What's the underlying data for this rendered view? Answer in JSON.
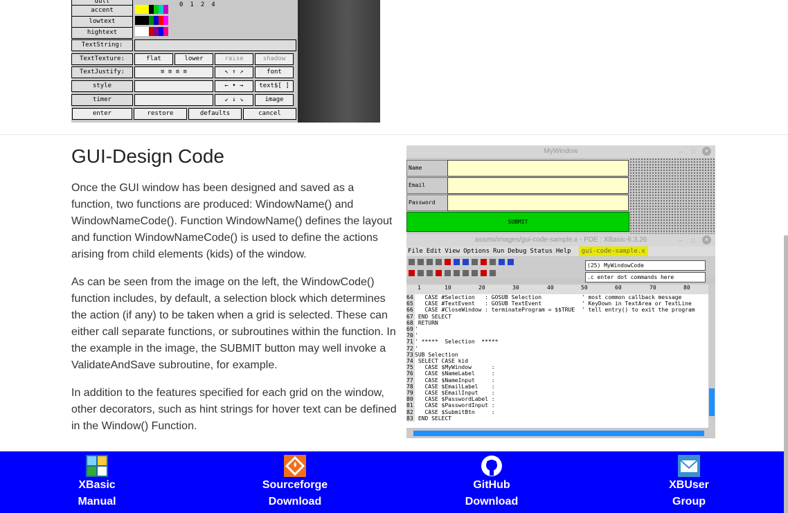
{
  "designer": {
    "rows": [
      {
        "label": "accent"
      },
      {
        "label": "lowtext"
      },
      {
        "label": "hightext"
      },
      {
        "label": "TextString:"
      },
      {
        "label": "TextTexture:",
        "buttons": [
          "flat",
          "lower",
          "raise",
          "shadow"
        ]
      },
      {
        "label": "TextJustify:",
        "buttons": [
          "font"
        ]
      },
      {
        "label": "style",
        "buttons": [
          "text$[ ]"
        ]
      },
      {
        "label": "timer",
        "buttons": [
          "image"
        ]
      }
    ],
    "numbers": [
      "0",
      "1",
      "2",
      "4"
    ],
    "bottom_buttons": [
      "enter",
      "restore",
      "defaults",
      "cancel"
    ]
  },
  "section": {
    "title": "GUI-Design Code",
    "paragraphs": [
      "Once the GUI window has been designed and saved as a function, two functions are produced: WindowName() and WindowNameCode(). Function WindowName() defines the layout and function WindowNameCode() is used to define the actions arising from child elements (kids) of the window.",
      "As can be seen from the image on the left, the WindowCode() function includes, by default, a selection block which determines the action (if any) to be taken when a grid is selected. These can either call separate functions, or subroutines within the function. In the example in the image, the SUBMIT button may well invoke a ValidateAndSave subroutine, for example.",
      "In addition to the features specified for each grid on the window, other decorators, such as hint strings for hover text can be defined in the Window() Function."
    ]
  },
  "screenshot": {
    "mywindow_title": "MyWindow",
    "labels": [
      "Name",
      "Email",
      "Password"
    ],
    "submit_label": "SUBMIT",
    "pde_title": "assets/images/gui-code-sample.x - PDE : XBasic-6.3.26",
    "menu": [
      "File",
      "Edit",
      "View",
      "Options",
      "Run",
      "Debug",
      "Status",
      "Help"
    ],
    "file_tag": "gui-code-sample.x",
    "func_select": "(25) MyWindowCode",
    "command_placeholder": ".c enter dot commands here",
    "ruler": [
      "1",
      "10",
      "20",
      "30",
      "40",
      "50",
      "60",
      "70",
      "80"
    ],
    "code_lines": [
      {
        "n": "64",
        "t": "   CASE #Selection   : GOSUB Selection            ' most common callback message"
      },
      {
        "n": "65",
        "t": "   CASE #TextEvent   : GOSUB TextEvent            ' KeyDown in TextArea or TextLine"
      },
      {
        "n": "66",
        "t": "   CASE #CloseWindow : terminateProgram = $$TRUE  ' tell entry() to exit the program"
      },
      {
        "n": "67",
        "t": " END SELECT"
      },
      {
        "n": "68",
        "t": " RETURN"
      },
      {
        "n": "69",
        "t": "'"
      },
      {
        "n": "70",
        "t": "'"
      },
      {
        "n": "71",
        "t": "' *****  Selection  *****"
      },
      {
        "n": "72",
        "t": "'"
      },
      {
        "n": "73",
        "t": "SUB Selection"
      },
      {
        "n": "74",
        "t": " SELECT CASE kid"
      },
      {
        "n": "75",
        "t": "   CASE $MyWindow      :"
      },
      {
        "n": "76",
        "t": "   CASE $NameLabel     :"
      },
      {
        "n": "77",
        "t": "   CASE $NameInput     :"
      },
      {
        "n": "78",
        "t": "   CASE $EmailLabel    :"
      },
      {
        "n": "79",
        "t": "   CASE $EmailInput    :"
      },
      {
        "n": "80",
        "t": "   CASE $PasswordLabel :"
      },
      {
        "n": "81",
        "t": "   CASE $PasswordInput :"
      },
      {
        "n": "82",
        "t": "   CASE $SubmitBtn     :"
      },
      {
        "n": "83",
        "t": " END SELECT"
      }
    ]
  },
  "footer": {
    "bg_color": "#0000ff",
    "items": [
      {
        "line1": "XBasic",
        "line2": "Manual",
        "icon": "xbasic-logo-icon"
      },
      {
        "line1": "Sourceforge",
        "line2": "Download",
        "icon": "sourceforge-icon"
      },
      {
        "line1": "GitHub",
        "line2": "Download",
        "icon": "github-icon"
      },
      {
        "line1": "XBUser",
        "line2": "Group",
        "icon": "mail-icon"
      }
    ]
  }
}
